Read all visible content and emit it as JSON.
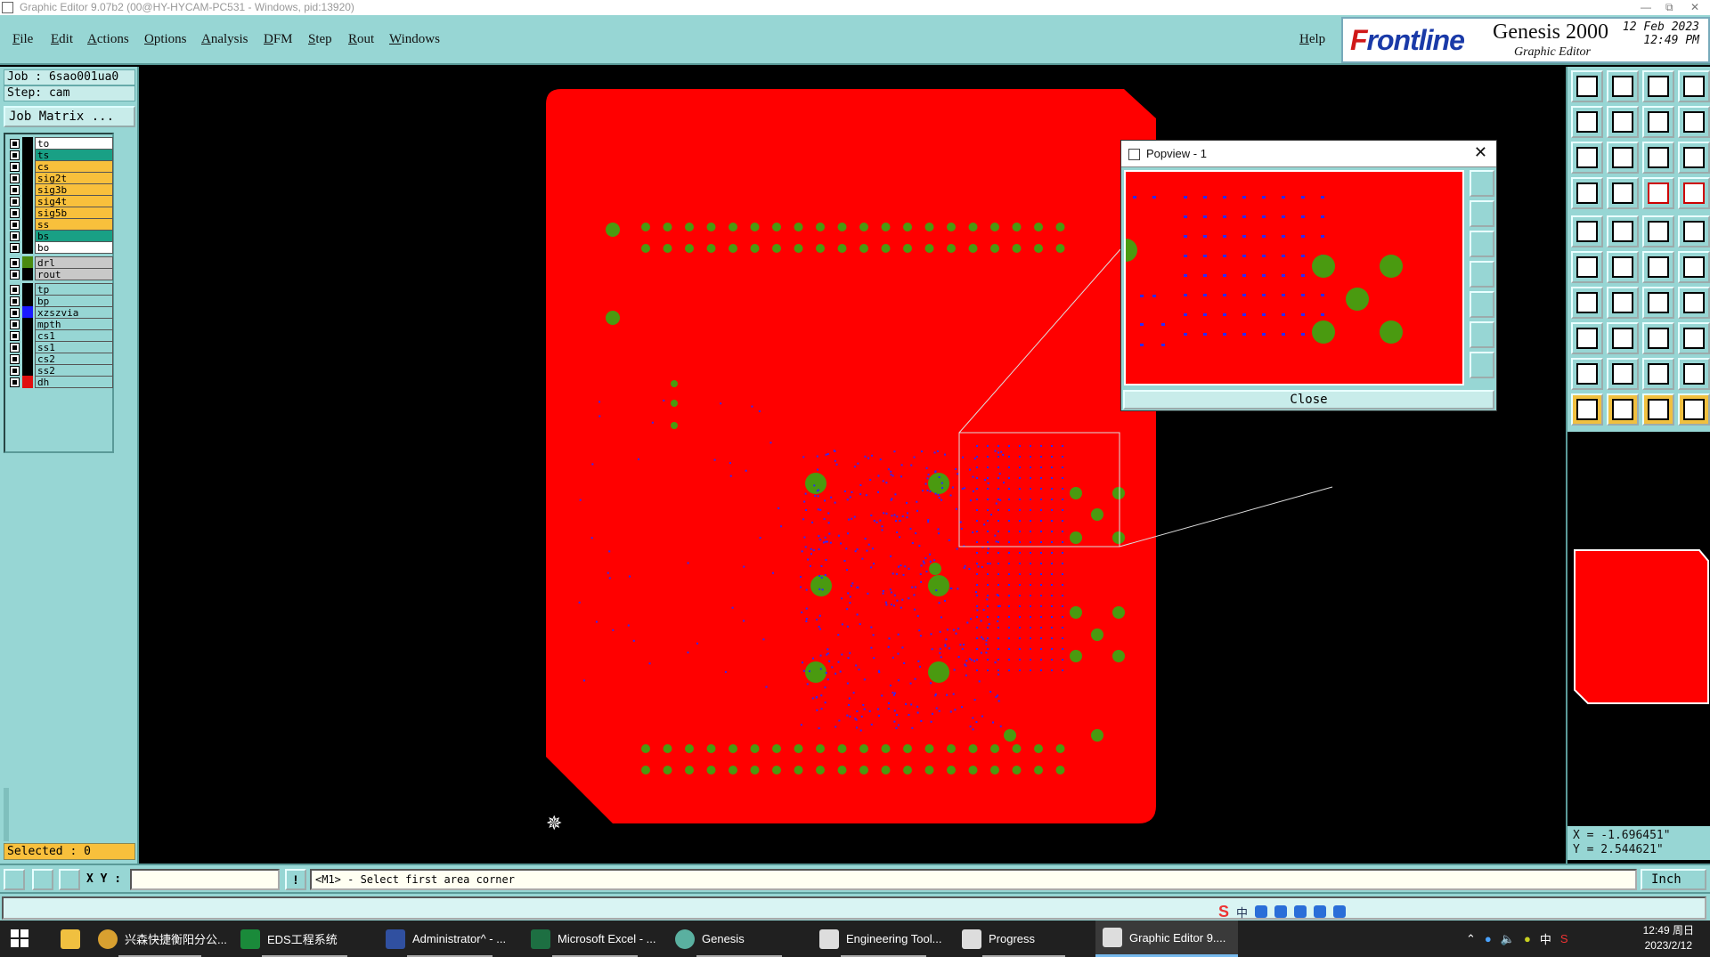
{
  "window": {
    "title": "Graphic Editor 9.07b2 (00@HY-HYCAM-PC531 - Windows, pid:13920)"
  },
  "menu": [
    "File",
    "Edit",
    "Actions",
    "Options",
    "Analysis",
    "DFM",
    "Step",
    "Rout",
    "Windows"
  ],
  "help_label": "Help",
  "brand": {
    "logo_a": "F",
    "logo_b": "rontline",
    "product": "Genesis 2000",
    "subtitle": "Graphic Editor",
    "date": "12 Feb 2023",
    "time": "12:49 PM"
  },
  "left": {
    "job": "Job : 6sao001ua0",
    "step": "Step: cam",
    "job_matrix": "Job Matrix ...",
    "layers": [
      {
        "name": "to",
        "bg": "#ffffff",
        "swatch": "#000000"
      },
      {
        "name": "ts",
        "bg": "#19a085",
        "swatch": "#000000"
      },
      {
        "name": "cs",
        "bg": "#f8c03c",
        "swatch": "#000000"
      },
      {
        "name": "sig2t",
        "bg": "#f8c03c",
        "swatch": "#000000"
      },
      {
        "name": "sig3b",
        "bg": "#f8c03c",
        "swatch": "#000000"
      },
      {
        "name": "sig4t",
        "bg": "#f8c03c",
        "swatch": "#000000"
      },
      {
        "name": "sig5b",
        "bg": "#f8c03c",
        "swatch": "#000000"
      },
      {
        "name": "ss",
        "bg": "#f8c03c",
        "swatch": "#000000"
      },
      {
        "name": "bs",
        "bg": "#19a085",
        "swatch": "#000000"
      },
      {
        "name": "bo",
        "bg": "#ffffff",
        "swatch": "#000000"
      },
      {
        "name": "drl",
        "bg": "#c8c8c8",
        "swatch": "#4a8a10"
      },
      {
        "name": "rout",
        "bg": "#c8c8c8",
        "swatch": "#000000"
      },
      {
        "name": "tp",
        "bg": "#97d6d4",
        "swatch": "#000000"
      },
      {
        "name": "bp",
        "bg": "#97d6d4",
        "swatch": "#000000"
      },
      {
        "name": "xzszvia",
        "bg": "#97d6d4",
        "swatch": "#1a1aff"
      },
      {
        "name": "mpth",
        "bg": "#97d6d4",
        "swatch": "#000000"
      },
      {
        "name": "cs1",
        "bg": "#97d6d4",
        "swatch": "#000000"
      },
      {
        "name": "ss1",
        "bg": "#97d6d4",
        "swatch": "#000000"
      },
      {
        "name": "cs2",
        "bg": "#97d6d4",
        "swatch": "#000000"
      },
      {
        "name": "ss2",
        "bg": "#97d6d4",
        "swatch": "#000000"
      },
      {
        "name": "dh",
        "bg": "#97d6d4",
        "swatch": "#e01010"
      }
    ],
    "selected": "Selected : 0"
  },
  "coords": {
    "x": "X = -1.696451\"",
    "y": "Y = 2.544621\""
  },
  "command": {
    "xy_label": "X Y :",
    "xy_value": "",
    "message": "<M1> - Select first area corner",
    "units": "Inch"
  },
  "popview": {
    "title": "Popview - 1",
    "close_label": "Close"
  },
  "colors": {
    "board": "#ff0000",
    "pad": "#4a9a10",
    "via": "#2a2aff",
    "panel": "#97d6d4"
  },
  "taskbar": {
    "tasks": [
      "兴森快捷衡阳分公...",
      "EDS工程系统",
      "Administrator^ - ...",
      "Microsoft Excel - ...",
      "Genesis",
      "Engineering Tool...",
      "Progress",
      "Graphic Editor 9...."
    ],
    "tray_lang": "中",
    "clock_time": "12:49 周日",
    "clock_date": "2023/2/12"
  }
}
